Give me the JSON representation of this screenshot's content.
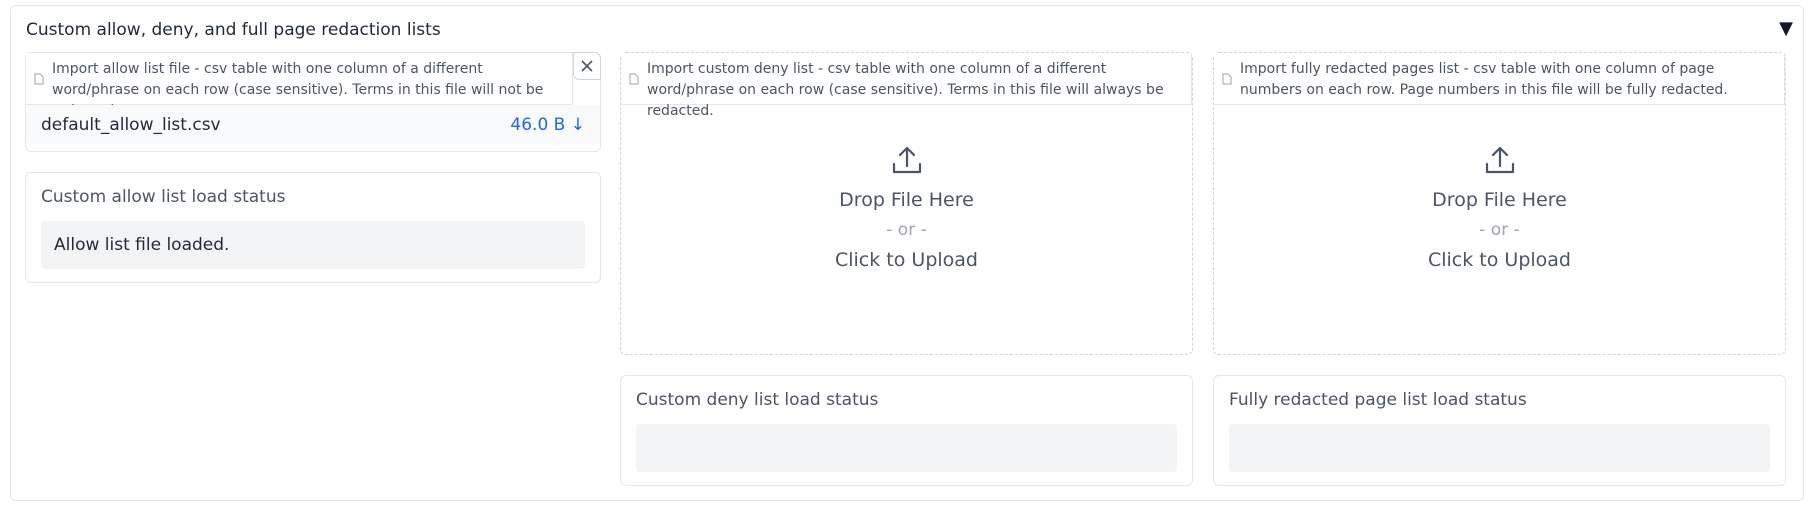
{
  "accordion": {
    "title": "Custom allow, deny, and full page redaction lists",
    "toggle_icon": "triangle-down-icon"
  },
  "allow": {
    "label": "Import allow list file - csv table with one column of a different word/phrase on each row (case sensitive). Terms in this file will not be redacted.",
    "file_name": "default_allow_list.csv",
    "file_size": "46.0 B ↓",
    "status_label": "Custom allow list load status",
    "status_value": "Allow list file loaded."
  },
  "deny": {
    "label": "Import custom deny list - csv table with one column of a different word/phrase on each row (case sensitive). Terms in this file will always be redacted.",
    "drop_text": "Drop File Here",
    "or_text": "- or -",
    "click_text": "Click to Upload",
    "status_label": "Custom deny list load status",
    "status_value": ""
  },
  "pages": {
    "label": "Import fully redacted pages list - csv table with one column of page numbers on each row. Page numbers in this file will be fully redacted.",
    "drop_text": "Drop File Here",
    "or_text": "- or -",
    "click_text": "Click to Upload",
    "status_label": "Fully redacted page list load status",
    "status_value": ""
  },
  "colors": {
    "accent_link": "#2563eb",
    "border": "#e5e7eb",
    "field_bg": "#f3f4f6"
  }
}
